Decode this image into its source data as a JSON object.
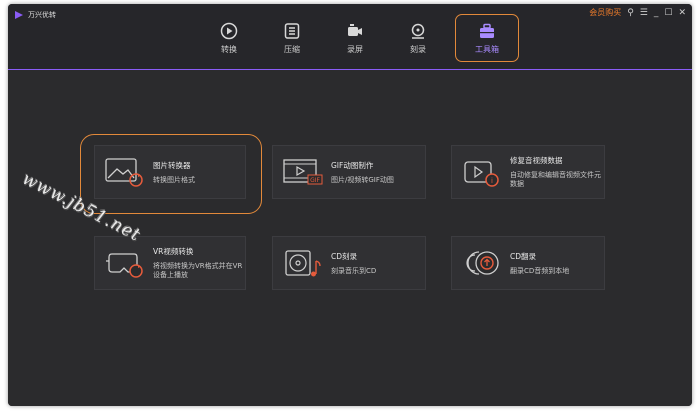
{
  "app": {
    "title": "万兴优转"
  },
  "window_controls": {
    "member": "会员购买",
    "search": "⚲",
    "menu": "☰",
    "minimize": "_",
    "maximize": "☐",
    "close": "✕"
  },
  "nav": [
    {
      "label": "转换",
      "icon": "convert-icon"
    },
    {
      "label": "压缩",
      "icon": "compress-icon"
    },
    {
      "label": "录屏",
      "icon": "record-icon"
    },
    {
      "label": "刻录",
      "icon": "burn-icon"
    },
    {
      "label": "工具箱",
      "icon": "toolbox-icon",
      "active": true
    }
  ],
  "tools": [
    {
      "title": "图片转换器",
      "desc": "转换图片格式",
      "icon": "image-convert-icon"
    },
    {
      "title": "GIF动图制作",
      "desc": "图片/视频转GIF动图",
      "icon": "gif-maker-icon"
    },
    {
      "title": "修复音视频数据",
      "desc": "自动修复和编辑音视频文件元数据",
      "icon": "metadata-fix-icon"
    },
    {
      "title": "VR视频转换",
      "desc": "将视频转换为VR格式并在VR设备上播放",
      "icon": "vr-convert-icon"
    },
    {
      "title": "CD刻录",
      "desc": "刻录音乐到CD",
      "icon": "cd-burn-icon"
    },
    {
      "title": "CD翻录",
      "desc": "翻录CD音频到本地",
      "icon": "cd-rip-icon"
    }
  ],
  "watermark": "www.jb51.net",
  "colors": {
    "accent": "#8a5cf6",
    "highlight": "#e2893a",
    "badge": "#e55b3c"
  }
}
